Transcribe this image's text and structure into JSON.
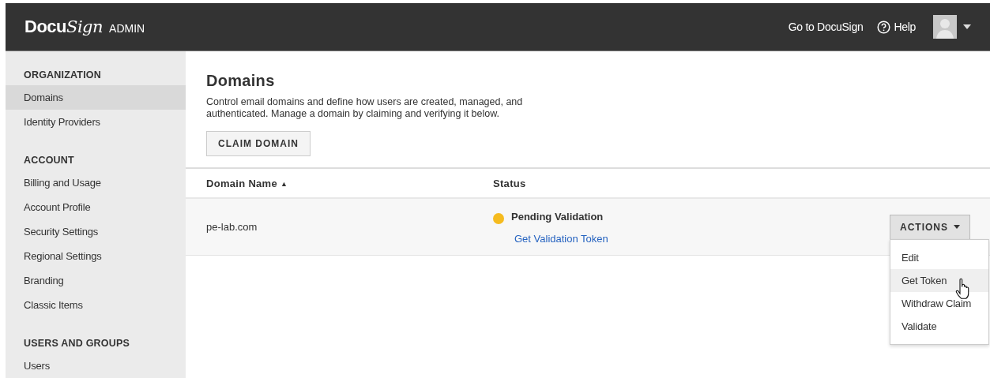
{
  "header": {
    "logo": [
      "Docu",
      "Sign"
    ],
    "product": "ADMIN",
    "links": [
      {
        "kind": "link",
        "label": "Go to DocuSign"
      },
      {
        "kind": "help",
        "label": "Help"
      }
    ]
  },
  "sidebar": {
    "sections": [
      {
        "title": "ORGANIZATION",
        "items": [
          {
            "label": "Domains",
            "selected": true
          },
          {
            "label": "Identity Providers",
            "selected": false
          }
        ]
      },
      {
        "title": "ACCOUNT",
        "items": [
          {
            "label": "Billing and Usage",
            "selected": false
          },
          {
            "label": "Account Profile",
            "selected": false
          },
          {
            "label": "Security Settings",
            "selected": false
          },
          {
            "label": "Regional Settings",
            "selected": false
          },
          {
            "label": "Branding",
            "selected": false
          },
          {
            "label": "Classic Items",
            "selected": false
          }
        ]
      },
      {
        "title": "USERS AND GROUPS",
        "items": [
          {
            "label": "Users",
            "selected": false
          }
        ]
      }
    ]
  },
  "page": {
    "title": "Domains",
    "description": "Control email domains and define how users are created, managed, and authenticated. Manage a domain by claiming and verifying it below.",
    "button": "CLAIM DOMAIN"
  },
  "table": {
    "columns": [
      {
        "label": "Domain Name",
        "sort": "▲"
      },
      {
        "label": "Status"
      }
    ],
    "rows": [
      {
        "domain": "pe-lab.com",
        "status": "Pending Validation",
        "color": "#f5bb1f",
        "link": "Get Validation Token",
        "actions": "ACTIONS",
        "menu_open": true
      }
    ]
  },
  "menu": {
    "items": [
      {
        "label": "Edit",
        "selected": false
      },
      {
        "label": "Get Token",
        "selected": true
      },
      {
        "label": "Withdraw Claim",
        "selected": false
      },
      {
        "label": "Validate",
        "selected": false
      }
    ]
  }
}
